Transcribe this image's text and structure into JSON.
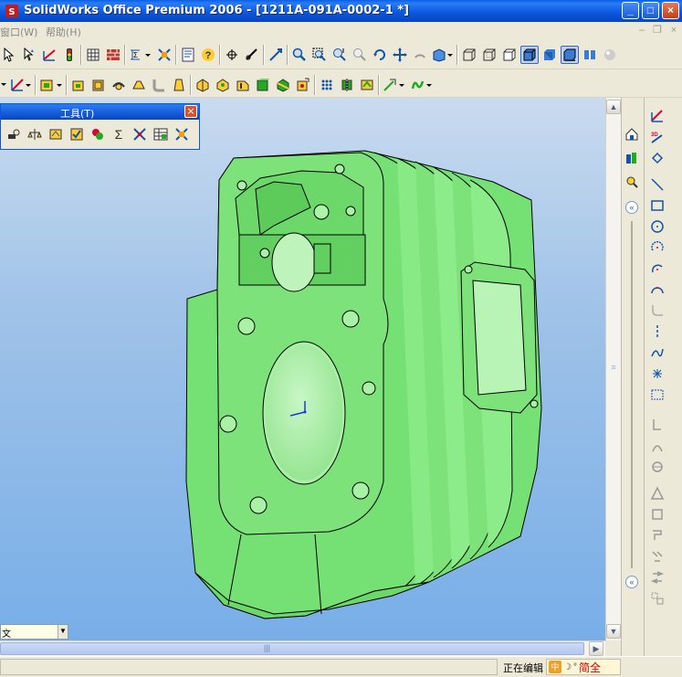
{
  "window": {
    "title": "SolidWorks Office Premium 2006 - [1211A-091A-0002-1 *]",
    "min": "_",
    "max": "□",
    "close": "×"
  },
  "menu": {
    "items": [
      {
        "label": "窗口(W)"
      },
      {
        "label": "帮助(H)"
      }
    ],
    "mdi_min": "–",
    "mdi_restore": "❐",
    "mdi_close": "×"
  },
  "tools_toolbar": {
    "title": "工具(T)",
    "close": "×"
  },
  "unit_select": {
    "value": "文"
  },
  "status": {
    "text": "正在编辑",
    "ime_label": "简全"
  },
  "colors": {
    "model": "#7ee27a",
    "viewport_top": "#c9dbef",
    "viewport_bottom": "#78aee8",
    "titlebar": "#0a56dd"
  }
}
